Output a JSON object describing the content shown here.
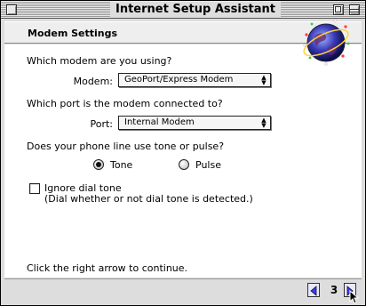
{
  "window": {
    "title": "Internet Setup Assistant"
  },
  "header": {
    "title": "Modem Settings",
    "logo_icon": "globe-icon"
  },
  "modem": {
    "question": "Which modem are you using?",
    "label": "Modem:",
    "selected": "GeoPort/Express Modem"
  },
  "port": {
    "question": "Which port is the modem connected to?",
    "label": "Port:",
    "selected": "Internal Modem"
  },
  "dial": {
    "question": "Does your phone line use tone or pulse?",
    "options": [
      {
        "label": "Tone",
        "selected": true
      },
      {
        "label": "Pulse",
        "selected": false
      }
    ]
  },
  "ignore_dial_tone": {
    "label": "Ignore dial tone",
    "hint": "(Dial whether or not dial tone is detected.)",
    "checked": false
  },
  "footer": {
    "instruction": "Click the right arrow to continue.",
    "page": "3"
  }
}
